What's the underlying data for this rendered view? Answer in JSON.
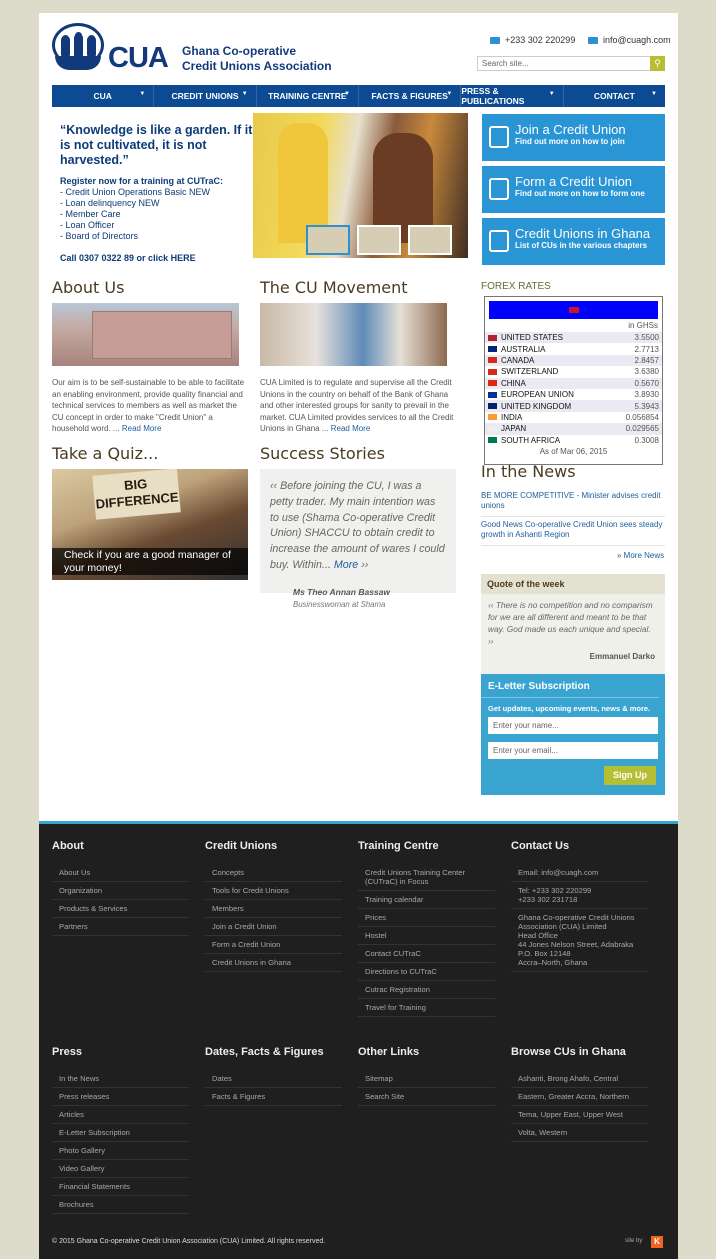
{
  "header": {
    "logo_text": "CUA",
    "org_name_line1": "Ghana Co-operative",
    "org_name_line2": "Credit Unions Association",
    "phone": "+233 302 220299",
    "email": "info@cuagh.com",
    "search_placeholder": "Search site..."
  },
  "nav": [
    "CUA",
    "CREDIT UNIONS",
    "TRAINING CENTRE",
    "FACTS & FIGURES",
    "PRESS & PUBLICATIONS",
    "CONTACT"
  ],
  "promo": {
    "quote": "“Knowledge is like a garden. If it is not cultivated, it is not harvested.”",
    "register": "Register now for a training at CUTraC:",
    "items": [
      "- Credit Union Operations Basic NEW",
      "- Loan delinquency  NEW",
      "- Member Care",
      "- Loan Officer",
      "- Board of Directors"
    ],
    "call": "Call 0307 0322 89 or click HERE"
  },
  "cta": [
    {
      "title": "Join a Credit Union",
      "sub": "Find out more on how to join",
      "icon": "pencil-icon"
    },
    {
      "title": "Form a Credit Union",
      "sub": "Find out more on how to form one",
      "icon": "add-document-icon"
    },
    {
      "title": "Credit Unions in Ghana",
      "sub": "List of CUs in the various chapters",
      "icon": "copy-icon"
    }
  ],
  "about": {
    "title": "About Us",
    "text": "Our aim is to be self-sustainable to be able to facilitate an enabling environment, provide quality financial and technical services to members as well as market the CU concept in order to make \"Credit Union\" a household word. ...",
    "more": "Read More"
  },
  "movement": {
    "title": "The CU Movement",
    "text": "CUA Limited is to regulate and supervise all the Credit Unions in the country on behalf of the Bank of Ghana and other interested groups for sanity to prevail in the market. CUA Limited provides services to all the Credit Unions in Ghana ...",
    "more": "Read More"
  },
  "quiz": {
    "title": "Take a Quiz...",
    "caption": "Check if you are a good manager of your money!",
    "banner_line1": "BIG",
    "banner_line2": "DIFFERENCE"
  },
  "success": {
    "title": "Success Stories",
    "text": "Before joining the CU, I was a petty trader. My main intention was to use (Shama Co-operative Credit Union) SHACCU to obtain credit to increase the amount of wares I could buy. Within...",
    "more": "More",
    "author": "Ms Theo Annan Bassaw",
    "role": "Businesswoman at Shama"
  },
  "forex": {
    "title": "FOREX RATES",
    "unit": "in GHSs",
    "rows": [
      {
        "name": "UNITED STATES",
        "value": "3.5500",
        "color": "#b22234"
      },
      {
        "name": "AUSTRALIA",
        "value": "2.7713",
        "color": "#00247d"
      },
      {
        "name": "CANADA",
        "value": "2.8457",
        "color": "#d52b1e"
      },
      {
        "name": "SWITZERLAND",
        "value": "3.6380",
        "color": "#d52b1e"
      },
      {
        "name": "CHINA",
        "value": "0.5670",
        "color": "#de2910"
      },
      {
        "name": "EUROPEAN UNION",
        "value": "3.8930",
        "color": "#003399"
      },
      {
        "name": "UNITED KINGDOM",
        "value": "5.3943",
        "color": "#012169"
      },
      {
        "name": "INDIA",
        "value": "0.056854",
        "color": "#ff9933"
      },
      {
        "name": "JAPAN",
        "value": "0.029565",
        "color": "#eeeeee"
      },
      {
        "name": "SOUTH AFRICA",
        "value": "0.3008",
        "color": "#007a4d"
      }
    ],
    "as_of": "As of Mar 06, 2015"
  },
  "news": {
    "title": "In the News",
    "items": [
      "BE MORE COMPETITIVE - Minister advises credit unions",
      "Good News Co-operative Credit Union sees steady growth in Ashanti Region"
    ],
    "more": "» More News"
  },
  "quote_week": {
    "title": "Quote of the week",
    "text": "There is no competition and no comparism for we are all different and meant to be that way. God made us each unique and special.",
    "author": "Emmanuel Darko"
  },
  "eletter": {
    "title": "E-Letter Subscription",
    "sub": "Get updates, upcoming events, news & more.",
    "name_placeholder": "Enter your name...",
    "email_placeholder": "Enter your email...",
    "button": "Sign Up"
  },
  "footer": {
    "cols_top": [
      {
        "title": "About",
        "links": [
          "About Us",
          "Organization",
          "Products & Services",
          "Partners"
        ]
      },
      {
        "title": "Credit Unions",
        "links": [
          "Concepts",
          "Tools for Credit Unions",
          "Members",
          "Join a Credit Union",
          "Form a Credit Union",
          "Credit Unions in Ghana"
        ]
      },
      {
        "title": "Training Centre",
        "links": [
          "Credit Unions Training Center (CUTraC) in Focus",
          "Training calendar",
          "Prices",
          "Hostel",
          "Contact CUTraC",
          "Directions to CUTraC",
          "Cutrac Registration",
          "Travel for Training"
        ]
      },
      {
        "title": "Contact Us",
        "links": [
          "Email: info@cuagh.com",
          "Tel: +233 302 220299\n+233 302 231718",
          "Ghana Co-operative Credit Unions Association (CUA) Limited\nHead Office\n44 Jones Nelson Street, Adabraka\nP.O. Box 12148\nAccra–North, Ghana"
        ]
      }
    ],
    "cols_bottom": [
      {
        "title": "Press",
        "links": [
          "In the News",
          "Press releases",
          "Articles",
          "E-Letter Subscription",
          "Photo Gallery",
          "Video Gallery",
          "Financial Statements",
          "Brochures"
        ]
      },
      {
        "title": "Dates, Facts & Figures",
        "links": [
          "Dates",
          "Facts & Figures"
        ]
      },
      {
        "title": "Other Links",
        "links": [
          "Sitemap",
          "Search Site"
        ]
      },
      {
        "title": "Browse CUs in Ghana",
        "links": [
          "Ashanti, Brong Ahafo, Central",
          "Eastern, Greater Accra, Northern",
          "Tema, Upper East, Upper West",
          "Volta, Western"
        ]
      }
    ],
    "copyright": "© 2015 Ghana Co-operative Credit Union Association (CUA) Limited. All rights reserved.",
    "site_by": "site by",
    "site_by_logo": "K"
  }
}
